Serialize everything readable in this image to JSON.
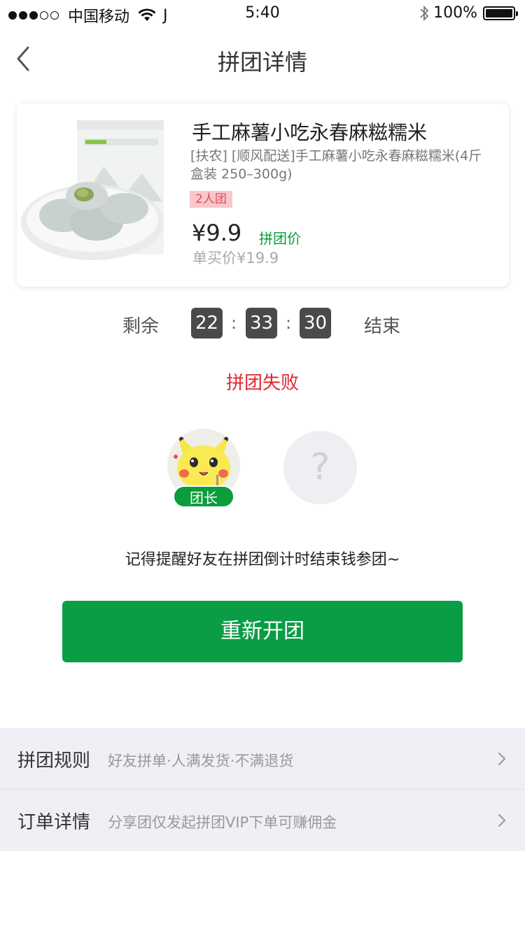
{
  "status_bar": {
    "carrier": "中国移动",
    "signal_extra": "J",
    "time": "5:40",
    "battery": "100%",
    "battery_level": 1.0,
    "signal_bars_filled": 3,
    "signal_bars_total": 5,
    "icons": [
      "wifi-icon",
      "bluetooth-icon",
      "battery-icon"
    ]
  },
  "nav": {
    "title": "拼团详情",
    "back_icon": "chevron-left-icon"
  },
  "product": {
    "title": "手工麻薯小吃永春麻糍糯米",
    "description": "[扶农] [顺风配送]手工麻薯小吃永春麻糍糯米(4斤盒装 250–300g)",
    "badge": "2人团",
    "price": "¥9.9",
    "price_label": "拼团价",
    "original_price": "单买价¥19.9"
  },
  "countdown": {
    "prefix": "剩余",
    "hours": "22",
    "minutes": "33",
    "seconds": "30",
    "separator": ":",
    "suffix": "结束"
  },
  "group": {
    "status": "拼团失败",
    "leader_tag": "团长",
    "empty_slot": "?",
    "reminder": "记得提醒好友在拼团倒计时结束钱参团~"
  },
  "action": {
    "restart_label": "重新开团"
  },
  "list": [
    {
      "title": "拼团规则",
      "subtitle": "好友拼单·人满发货·不满退货"
    },
    {
      "title": "订单详情",
      "subtitle": "分享团仅发起拼团VIP下单可赚佣金"
    }
  ],
  "colors": {
    "brand_green": "#0b9c46",
    "fail_red": "#e0262f",
    "badge_bg": "#f7c7cb",
    "badge_text": "#e44c55",
    "countdown_bg": "#4a4a4a",
    "list_bg": "#eff0f5"
  }
}
